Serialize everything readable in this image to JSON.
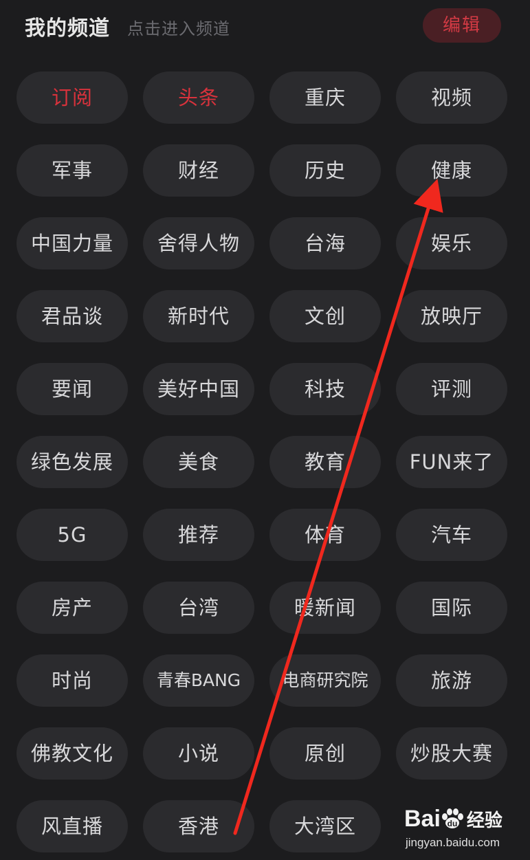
{
  "header": {
    "title": "我的频道",
    "hint": "点击进入频道",
    "edit_label": "编辑"
  },
  "colors": {
    "background": "#1c1c1e",
    "chip": "#2b2b2e",
    "active_text": "#d8323c",
    "edit_button_bg": "#4a1f24",
    "annotation_arrow": "#f0281e"
  },
  "channels": [
    {
      "label": "订阅",
      "active": true
    },
    {
      "label": "头条",
      "active": true
    },
    {
      "label": "重庆"
    },
    {
      "label": "视频"
    },
    {
      "label": "军事"
    },
    {
      "label": "财经"
    },
    {
      "label": "历史"
    },
    {
      "label": "健康"
    },
    {
      "label": "中国力量"
    },
    {
      "label": "舍得人物"
    },
    {
      "label": "台海"
    },
    {
      "label": "娱乐"
    },
    {
      "label": "君品谈"
    },
    {
      "label": "新时代"
    },
    {
      "label": "文创"
    },
    {
      "label": "放映厅"
    },
    {
      "label": "要闻"
    },
    {
      "label": "美好中国"
    },
    {
      "label": "科技"
    },
    {
      "label": "评测"
    },
    {
      "label": "绿色发展"
    },
    {
      "label": "美食"
    },
    {
      "label": "教育"
    },
    {
      "label": "FUN来了"
    },
    {
      "label": "5G"
    },
    {
      "label": "推荐"
    },
    {
      "label": "体育"
    },
    {
      "label": "汽车"
    },
    {
      "label": "房产"
    },
    {
      "label": "台湾"
    },
    {
      "label": "暖新闻"
    },
    {
      "label": "国际"
    },
    {
      "label": "时尚"
    },
    {
      "label": "青春BANG",
      "small": true
    },
    {
      "label": "电商研究院",
      "small": true
    },
    {
      "label": "旅游"
    },
    {
      "label": "佛教文化"
    },
    {
      "label": "小说"
    },
    {
      "label": "原创"
    },
    {
      "label": "炒股大赛"
    },
    {
      "label": "风直播"
    },
    {
      "label": "香港"
    },
    {
      "label": "大湾区"
    }
  ],
  "watermark": {
    "logo_text": "Bai",
    "logo_icon": "paw-icon",
    "logo_suffix": "经验",
    "url": "jingyan.baidu.com"
  }
}
